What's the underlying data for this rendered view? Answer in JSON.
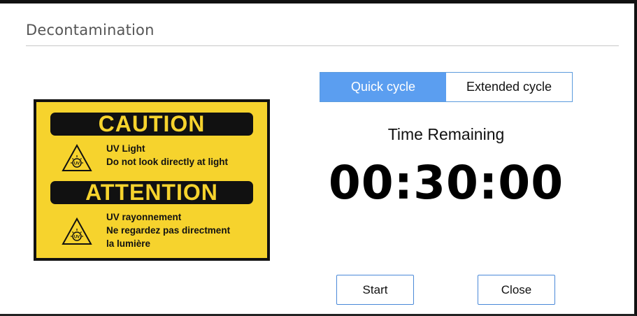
{
  "dialog": {
    "title": "Decontamination"
  },
  "sign": {
    "caution": "CAUTION",
    "caution_lines": [
      "UV Light",
      "Do not look directly at light"
    ],
    "attention": "ATTENTION",
    "attention_lines": [
      "UV rayonnement",
      "Ne regardez pas directment",
      "la lumière"
    ],
    "icon_label": "UV",
    "colors": {
      "background": "#f6d32d",
      "banner": "#111111"
    }
  },
  "cycle_selector": {
    "options": [
      {
        "label": "Quick cycle",
        "selected": true
      },
      {
        "label": "Extended cycle",
        "selected": false
      }
    ],
    "accent": "#5b9ef0"
  },
  "timer": {
    "label": "Time Remaining",
    "value": "00:30:00"
  },
  "buttons": {
    "start": "Start",
    "close": "Close"
  },
  "icons": [
    "uv-warning-icon"
  ]
}
